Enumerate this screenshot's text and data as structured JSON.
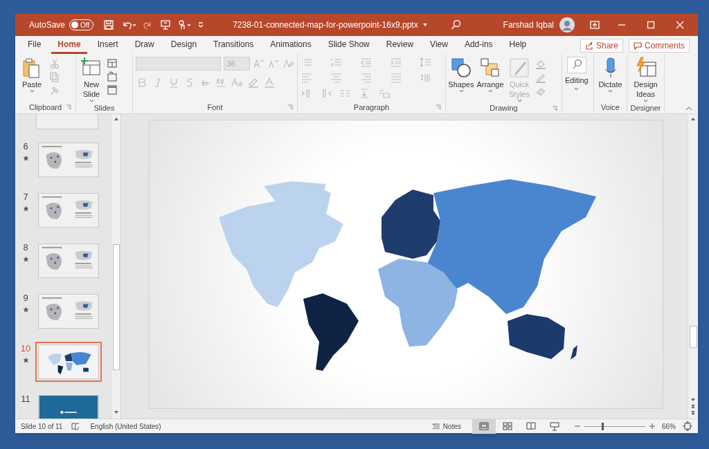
{
  "title_bar": {
    "autosave_label": "AutoSave",
    "autosave_toggle": {
      "label": "Off",
      "on": false
    },
    "file_name": "7238-01-connected-map-for-powerpoint-16x9.pptx",
    "user_name": "Farshad Iqbal"
  },
  "menu_tabs": [
    {
      "label": "File",
      "selected": false
    },
    {
      "label": "Home",
      "selected": true
    },
    {
      "label": "Insert",
      "selected": false
    },
    {
      "label": "Draw",
      "selected": false
    },
    {
      "label": "Design",
      "selected": false
    },
    {
      "label": "Transitions",
      "selected": false
    },
    {
      "label": "Animations",
      "selected": false
    },
    {
      "label": "Slide Show",
      "selected": false
    },
    {
      "label": "Review",
      "selected": false
    },
    {
      "label": "View",
      "selected": false
    },
    {
      "label": "Add-ins",
      "selected": false
    },
    {
      "label": "Help",
      "selected": false
    }
  ],
  "share_button": "Share",
  "comments_button": "Comments",
  "ribbon": {
    "groups": [
      {
        "kind": "clipboard",
        "label": "Clipboard",
        "buttons": [
          {
            "label": "Paste",
            "disabled": false
          }
        ]
      },
      {
        "kind": "slides",
        "label": "Slides",
        "buttons": [
          {
            "label": "New Slide",
            "disabled": false
          }
        ]
      },
      {
        "kind": "font",
        "label": "Font",
        "font_size": {
          "value": "36",
          "disabled": true
        }
      },
      {
        "kind": "paragraph",
        "label": "Paragraph"
      },
      {
        "kind": "drawing",
        "label": "Drawing",
        "buttons": [
          {
            "label": "Shapes",
            "disabled": false
          },
          {
            "label": "Arrange",
            "disabled": false
          },
          {
            "label": "Quick Styles",
            "disabled": true
          }
        ]
      },
      {
        "kind": "editing",
        "buttons": [
          {
            "label": "Editing",
            "disabled": false
          }
        ]
      },
      {
        "kind": "voice",
        "label": "Voice",
        "buttons": [
          {
            "label": "Dictate",
            "disabled": false
          }
        ]
      },
      {
        "kind": "designer",
        "label": "Designer",
        "buttons": [
          {
            "label": "Design Ideas",
            "disabled": false
          }
        ]
      }
    ]
  },
  "slides": [
    {
      "number": "6",
      "starred": true,
      "selected": false,
      "kind": "map"
    },
    {
      "number": "7",
      "starred": true,
      "selected": false,
      "kind": "map"
    },
    {
      "number": "8",
      "starred": true,
      "selected": false,
      "kind": "map"
    },
    {
      "number": "9",
      "starred": true,
      "selected": false,
      "kind": "map"
    },
    {
      "number": "10",
      "starred": true,
      "selected": true,
      "kind": "world"
    },
    {
      "number": "11",
      "starred": false,
      "selected": false,
      "kind": "title"
    }
  ],
  "status_bar": {
    "slide_info": "Slide 10 of 11",
    "language": "English (United States)",
    "notes_button": "Notes",
    "views": [
      {
        "kind": "normal",
        "selected": true
      },
      {
        "kind": "sorter",
        "selected": false
      },
      {
        "kind": "reading",
        "selected": false
      },
      {
        "kind": "slideshow",
        "selected": false
      }
    ],
    "zoom": {
      "level": 0.3,
      "label": "66%"
    }
  }
}
